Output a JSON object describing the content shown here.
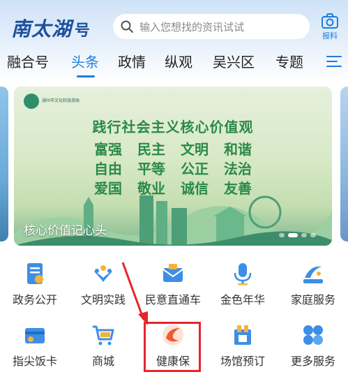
{
  "header": {
    "logo_main": "南太湖",
    "logo_sub": "号",
    "search_placeholder": "输入您想找的资讯试试",
    "search_icon": "search-icon",
    "report_icon": "camera-icon",
    "report_label": "报料"
  },
  "tabs": [
    {
      "label": "融合号",
      "active": false
    },
    {
      "label": "头条",
      "active": true
    },
    {
      "label": "政情",
      "active": false
    },
    {
      "label": "纵观",
      "active": false
    },
    {
      "label": "吴兴区",
      "active": false
    },
    {
      "label": "专题",
      "active": false
    }
  ],
  "banner": {
    "org_name": "湖州市文化和旅游局",
    "title": "践行社会主义核心价值观",
    "rows": [
      [
        "富强",
        "民主",
        "文明",
        "和谐"
      ],
      [
        "自由",
        "平等",
        "公正",
        "法治"
      ],
      [
        "爱国",
        "敬业",
        "诚信",
        "友善"
      ]
    ],
    "caption": "核心价值记心头",
    "slide_count": 4,
    "active_slide": 1
  },
  "services": [
    {
      "label": "政务公开",
      "icon": "government-document-icon"
    },
    {
      "label": "文明实践",
      "icon": "civilization-practice-icon"
    },
    {
      "label": "民意直通车",
      "icon": "envelope-icon"
    },
    {
      "label": "金色年华",
      "icon": "microphone-icon"
    },
    {
      "label": "家庭服务",
      "icon": "family-service-icon"
    },
    {
      "label": "指尖饭卡",
      "icon": "meal-card-icon"
    },
    {
      "label": "商城",
      "icon": "shopping-cart-icon"
    },
    {
      "label": "健康保",
      "icon": "health-insurance-icon"
    },
    {
      "label": "场馆预订",
      "icon": "venue-booking-icon"
    },
    {
      "label": "更多服务",
      "icon": "more-services-icon"
    }
  ],
  "colors": {
    "accent": "#1c7de0",
    "highlight": "#e5262b",
    "banner_text": "#2a8a48"
  }
}
